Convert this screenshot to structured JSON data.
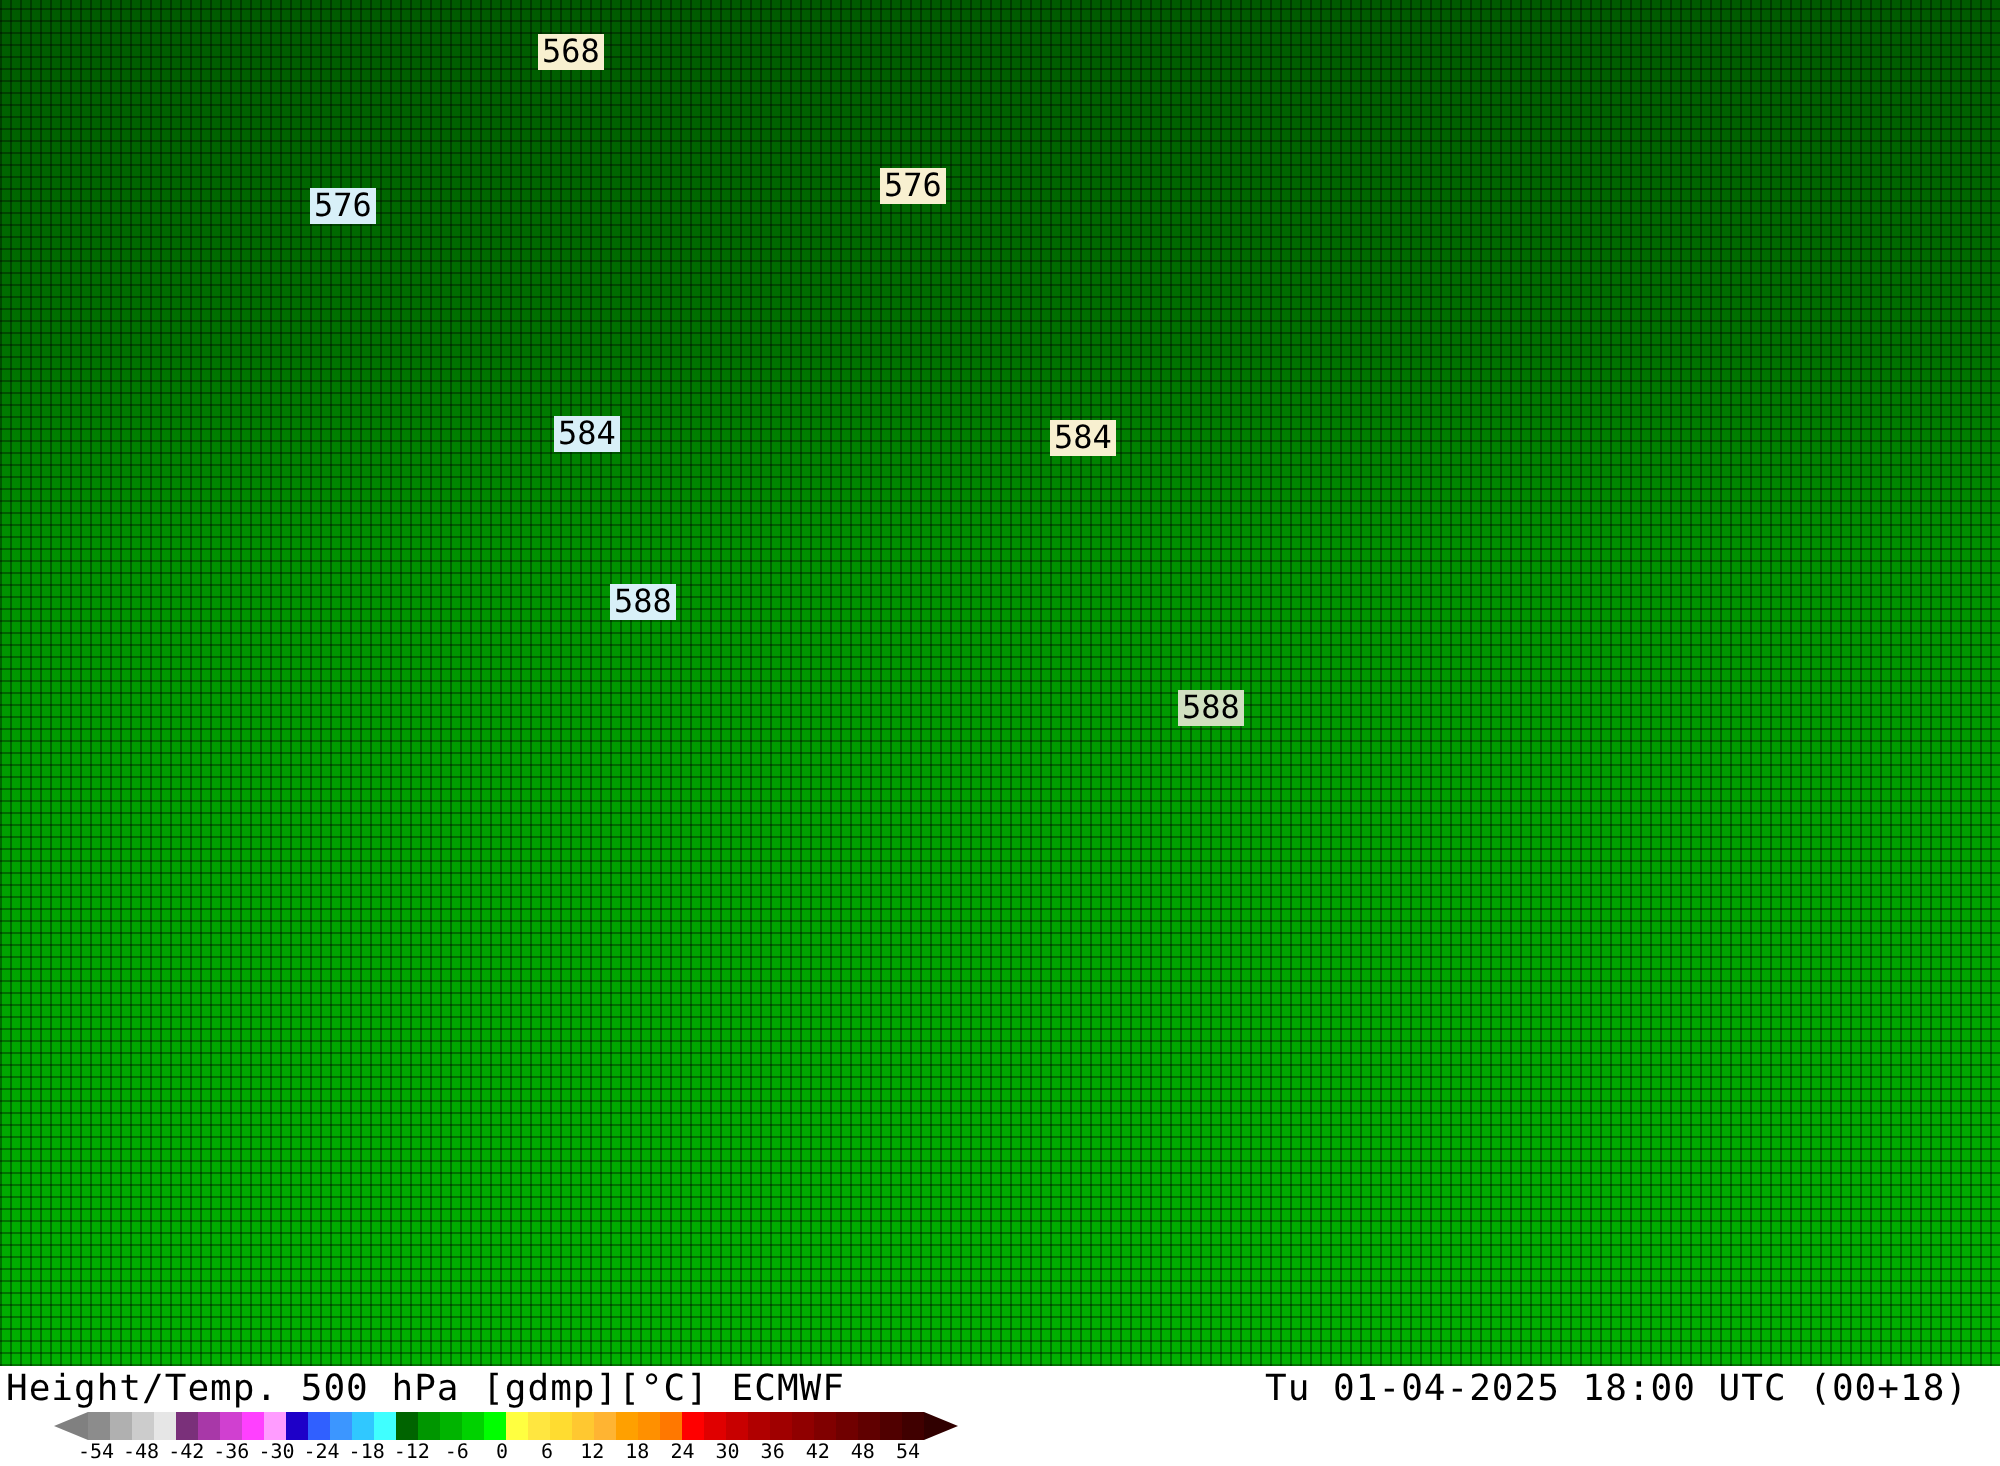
{
  "map": {
    "contour_labels": [
      {
        "text": "568",
        "color": "#f8f0d0"
      },
      {
        "text": "576",
        "color": "#d8f0f8"
      },
      {
        "text": "576",
        "color": "#f8f0d0"
      },
      {
        "text": "584",
        "color": "#d8f0f8"
      },
      {
        "text": "584",
        "color": "#f8f0d0"
      },
      {
        "text": "588",
        "color": "#d8f0f8"
      },
      {
        "text": "588",
        "color": "#d0e0c0"
      }
    ]
  },
  "footer": {
    "title": "Height/Temp. 500 hPa [gdmp][°C] ECMWF",
    "valid_time": "Tu 01-04-2025 18:00 UTC (00+18)"
  },
  "colorbar": {
    "segments": [
      {
        "kind": "under",
        "color": "#808080"
      },
      {
        "color": "#8c8c8c"
      },
      {
        "color": "#b0b0b0"
      },
      {
        "color": "#cccccc"
      },
      {
        "color": "#e6e6e6"
      },
      {
        "color": "#7a307a"
      },
      {
        "color": "#a838a8"
      },
      {
        "color": "#d040d0"
      },
      {
        "color": "#ff40ff"
      },
      {
        "color": "#ff9cff"
      },
      {
        "color": "#1e00c8"
      },
      {
        "color": "#3060ff"
      },
      {
        "color": "#3c96ff"
      },
      {
        "color": "#30c8ff"
      },
      {
        "color": "#40ffff"
      },
      {
        "color": "#006400"
      },
      {
        "color": "#009600"
      },
      {
        "color": "#00b400"
      },
      {
        "color": "#00d200"
      },
      {
        "color": "#00ff00"
      },
      {
        "color": "#ffff40"
      },
      {
        "color": "#ffe640"
      },
      {
        "color": "#ffdc30"
      },
      {
        "color": "#ffc830"
      },
      {
        "color": "#ffb432"
      },
      {
        "color": "#ffa000"
      },
      {
        "color": "#ff9000"
      },
      {
        "color": "#ff7800"
      },
      {
        "color": "#ff0000"
      },
      {
        "color": "#e00000"
      },
      {
        "color": "#c80000"
      },
      {
        "color": "#b00000"
      },
      {
        "color": "#a00000"
      },
      {
        "color": "#900000"
      },
      {
        "color": "#800000"
      },
      {
        "color": "#700000"
      },
      {
        "color": "#600000"
      },
      {
        "color": "#500000"
      },
      {
        "color": "#400000"
      },
      {
        "kind": "over",
        "color": "#300000"
      }
    ],
    "tick_labels": [
      "-54",
      "-48",
      "-42",
      "-36",
      "-30",
      "-24",
      "-18",
      "-12",
      "-6",
      "0",
      "6",
      "12",
      "18",
      "24",
      "30",
      "36",
      "42",
      "48",
      "54"
    ]
  }
}
